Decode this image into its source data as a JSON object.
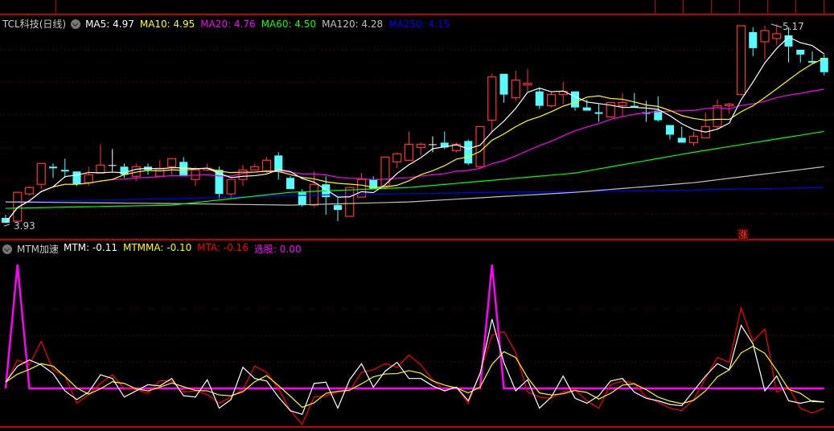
{
  "colors": {
    "up": "#ff3232",
    "down": "#54ffff",
    "flat": "#ffffff",
    "grid": "#8b0000",
    "divider": "#c00000",
    "ma5": "#ffffff",
    "ma10": "#ffff00",
    "ma20": "#ff00ff",
    "ma60": "#00ff00",
    "ma120": "#c0c0c0",
    "ma250": "#0000ff",
    "mtm": "#ffffff",
    "mtmma": "#ffff00",
    "mta": "#ff0000",
    "xuangu": "#ff00ff"
  },
  "main_legend": {
    "title": "TCL科技(日线)",
    "items": [
      {
        "label": "MA5: 4.97",
        "color": "#ffffff"
      },
      {
        "label": "MA10: 4.95",
        "color": "#ffff00"
      },
      {
        "label": "MA20: 4.76",
        "color": "#ff00ff"
      },
      {
        "label": "MA60: 4.50",
        "color": "#00ff00"
      },
      {
        "label": "MA120: 4.28",
        "color": "#c0c0c0"
      },
      {
        "label": "MA250: 4.15",
        "color": "#0000ff"
      }
    ]
  },
  "sub_legend": {
    "title": "MTM加速",
    "items": [
      {
        "label": "MTM: -0.11",
        "color": "#ffffff"
      },
      {
        "label": "MTMMA: -0.10",
        "color": "#ffff00"
      },
      {
        "label": "MTA: -0.16",
        "color": "#ff0000"
      },
      {
        "label": "选股: 0.00",
        "color": "#ff00ff"
      }
    ]
  },
  "annotations": {
    "low_label": "3.93",
    "high_label": "5.17",
    "rise_marker": "涨"
  },
  "chart_data": [
    {
      "type": "candlestick",
      "ylim": [
        3.85,
        5.22
      ],
      "ohlc": [
        [
          3.96,
          3.98,
          3.93,
          3.93
        ],
        [
          3.94,
          4.12,
          3.93,
          4.12
        ],
        [
          4.11,
          4.16,
          4.1,
          4.15
        ],
        [
          4.17,
          4.3,
          4.14,
          4.3
        ],
        [
          4.28,
          4.3,
          4.21,
          4.27
        ],
        [
          4.26,
          4.33,
          4.21,
          4.25
        ],
        [
          4.25,
          4.25,
          4.16,
          4.17
        ],
        [
          4.18,
          4.28,
          4.16,
          4.23
        ],
        [
          4.24,
          4.42,
          4.24,
          4.29
        ],
        [
          4.29,
          4.39,
          4.25,
          4.29
        ],
        [
          4.28,
          4.3,
          4.21,
          4.23
        ],
        [
          4.22,
          4.3,
          4.19,
          4.28
        ],
        [
          4.28,
          4.3,
          4.23,
          4.26
        ],
        [
          4.22,
          4.32,
          4.22,
          4.27
        ],
        [
          4.28,
          4.33,
          4.23,
          4.33
        ],
        [
          4.31,
          4.34,
          4.22,
          4.22
        ],
        [
          4.2,
          4.28,
          4.16,
          4.26
        ],
        [
          4.26,
          4.3,
          4.25,
          4.27
        ],
        [
          4.26,
          4.28,
          4.08,
          4.11
        ],
        [
          4.11,
          4.2,
          4.08,
          4.2
        ],
        [
          4.2,
          4.29,
          4.16,
          4.26
        ],
        [
          4.26,
          4.3,
          4.26,
          4.28
        ],
        [
          4.25,
          4.34,
          4.24,
          4.32
        ],
        [
          4.35,
          4.37,
          4.2,
          4.25
        ],
        [
          4.21,
          4.22,
          4.14,
          4.14
        ],
        [
          4.12,
          4.14,
          4.03,
          4.04
        ],
        [
          4.04,
          4.25,
          4.03,
          4.17
        ],
        [
          4.17,
          4.22,
          3.98,
          4.09
        ],
        [
          4.04,
          4.09,
          3.94,
          4.01
        ],
        [
          3.97,
          4.15,
          3.97,
          4.15
        ],
        [
          4.09,
          4.24,
          4.09,
          4.2
        ],
        [
          4.2,
          4.22,
          4.14,
          4.14
        ],
        [
          4.16,
          4.34,
          4.16,
          4.34
        ],
        [
          4.31,
          4.37,
          4.27,
          4.36
        ],
        [
          4.32,
          4.5,
          4.32,
          4.42
        ],
        [
          4.4,
          4.43,
          4.35,
          4.42
        ],
        [
          4.42,
          4.47,
          4.37,
          4.42
        ],
        [
          4.43,
          4.5,
          4.39,
          4.4
        ],
        [
          4.38,
          4.43,
          4.37,
          4.42
        ],
        [
          4.44,
          4.45,
          4.29,
          4.3
        ],
        [
          4.28,
          4.53,
          4.27,
          4.53
        ],
        [
          4.57,
          4.86,
          4.49,
          4.84
        ],
        [
          4.86,
          4.86,
          4.68,
          4.73
        ],
        [
          4.71,
          4.88,
          4.69,
          4.82
        ],
        [
          4.79,
          4.89,
          4.75,
          4.8
        ],
        [
          4.75,
          4.77,
          4.64,
          4.66
        ],
        [
          4.66,
          4.75,
          4.65,
          4.73
        ],
        [
          4.73,
          4.81,
          4.67,
          4.75
        ],
        [
          4.75,
          4.75,
          4.63,
          4.65
        ],
        [
          4.65,
          4.7,
          4.63,
          4.63
        ],
        [
          4.62,
          4.67,
          4.56,
          4.61
        ],
        [
          4.59,
          4.68,
          4.59,
          4.68
        ],
        [
          4.66,
          4.74,
          4.59,
          4.68
        ],
        [
          4.66,
          4.74,
          4.65,
          4.65
        ],
        [
          4.62,
          4.69,
          4.56,
          4.61
        ],
        [
          4.63,
          4.72,
          4.56,
          4.57
        ],
        [
          4.54,
          4.54,
          4.45,
          4.48
        ],
        [
          4.46,
          4.53,
          4.43,
          4.43
        ],
        [
          4.43,
          4.5,
          4.41,
          4.47
        ],
        [
          4.46,
          4.62,
          4.46,
          4.53
        ],
        [
          4.53,
          4.7,
          4.51,
          4.66
        ],
        [
          4.66,
          4.68,
          4.61,
          4.67
        ],
        [
          4.73,
          5.16,
          4.73,
          5.16
        ],
        [
          5.12,
          5.15,
          4.97,
          5.02
        ],
        [
          5.06,
          5.16,
          4.95,
          5.13
        ],
        [
          5.08,
          5.17,
          5.04,
          5.11
        ],
        [
          5.1,
          5.15,
          4.93,
          5.03
        ],
        [
          5.01,
          5.01,
          4.93,
          4.98
        ],
        [
          4.94,
          5.0,
          4.92,
          4.93
        ],
        [
          4.96,
          4.98,
          4.85,
          4.87
        ]
      ],
      "long_ma": {
        "ma60": [
          [
            0,
            4.02
          ],
          [
            14,
            4.04
          ],
          [
            24,
            4.12
          ],
          [
            34,
            4.15
          ],
          [
            48,
            4.24
          ],
          [
            58,
            4.37
          ],
          [
            69,
            4.5
          ]
        ],
        "ma120": [
          [
            0,
            4.06
          ],
          [
            14,
            4.05
          ],
          [
            24,
            4.04
          ],
          [
            34,
            4.06
          ],
          [
            41,
            4.09
          ],
          [
            48,
            4.12
          ],
          [
            58,
            4.18
          ],
          [
            69,
            4.28
          ]
        ],
        "ma250": [
          [
            0,
            4.06
          ],
          [
            14,
            4.08
          ],
          [
            24,
            4.1
          ],
          [
            41,
            4.12
          ],
          [
            55,
            4.13
          ],
          [
            69,
            4.15
          ]
        ]
      }
    },
    {
      "type": "line",
      "ylim": [
        -0.3,
        0.7
      ],
      "series": [
        {
          "name": "MTM",
          "values": [
            0.05,
            0.18,
            0.23,
            0.19,
            0.12,
            -0.02,
            -0.09,
            -0.03,
            0.11,
            0.08,
            -0.07,
            -0.02,
            0.03,
            0.02,
            0.08,
            -0.06,
            -0.07,
            0.07,
            -0.16,
            -0.09,
            0.17,
            0.08,
            0.06,
            -0.07,
            -0.18,
            -0.21,
            0.04,
            0.05,
            -0.16,
            0.07,
            0.2,
            0.01,
            0.14,
            0.21,
            0.08,
            0.08,
            0.02,
            -0.02,
            0.01,
            -0.1,
            0.12,
            0.56,
            0.21,
            -0.02,
            0.07,
            -0.16,
            -0.07,
            0.1,
            -0.08,
            -0.12,
            -0.06,
            0.06,
            0.08,
            -0.03,
            -0.08,
            -0.1,
            -0.13,
            -0.14,
            -0.02,
            0.1,
            0.2,
            0.15,
            0.51,
            0.36,
            -0.02,
            0.1,
            -0.1,
            -0.12,
            -0.1,
            -0.11
          ]
        },
        {
          "name": "MTA",
          "values": [
            0.04,
            0.23,
            0.19,
            0.38,
            0.15,
            0.1,
            -0.12,
            -0.05,
            0.04,
            0.11,
            0.0,
            -0.01,
            -0.04,
            0.06,
            0.06,
            -0.03,
            -0.02,
            -0.05,
            -0.12,
            -0.07,
            -0.01,
            0.18,
            0.13,
            0.0,
            -0.18,
            -0.29,
            -0.07,
            -0.06,
            -0.03,
            -0.02,
            0.13,
            0.15,
            0.2,
            0.17,
            0.27,
            0.19,
            0.07,
            -0.02,
            0.01,
            -0.12,
            0.13,
            0.43,
            0.46,
            0.29,
            -0.03,
            -0.07,
            -0.08,
            -0.03,
            -0.01,
            -0.1,
            -0.16,
            0.03,
            0.06,
            0.04,
            -0.07,
            -0.11,
            -0.16,
            -0.18,
            -0.09,
            0.08,
            0.25,
            0.21,
            0.65,
            0.38,
            0.48,
            -0.03,
            0.01,
            -0.16,
            -0.2,
            -0.16
          ]
        },
        {
          "name": "选股",
          "spikes_at_index": [
            1,
            41
          ],
          "spike_value": 1.0
        }
      ]
    }
  ]
}
